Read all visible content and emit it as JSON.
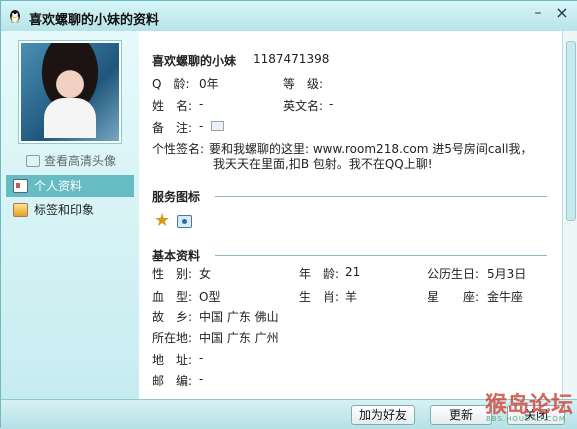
{
  "window": {
    "title": "喜欢螺聊的小妹的资料"
  },
  "sidebar": {
    "hd_link": "查看高清头像",
    "items": [
      {
        "label": "个人资料",
        "active": true,
        "icon": "profile-card-icon"
      },
      {
        "label": "标签和印象",
        "active": false,
        "icon": "tag-icon"
      }
    ]
  },
  "profile": {
    "nickname": "喜欢螺聊的小妹",
    "qq_number": "1187471398",
    "q_age_label": "Q　龄:",
    "q_age_value": "0年",
    "level_label": "等　级:",
    "name_label": "姓　名:",
    "name_value": "-",
    "english_name_label": "英文名:",
    "english_name_value": "-",
    "memo_label": "备　注:",
    "memo_value": "-",
    "signature_label": "个性签名:",
    "signature_line1": "要和我螺聊的这里: www.room218.com 进5号房间call我，",
    "signature_line2": "我天天在里面,扣B 包射。我不在QQ上聊!"
  },
  "services": {
    "title": "服务图标",
    "icons": [
      "star-icon",
      "camera-icon"
    ]
  },
  "basic": {
    "title": "基本资料",
    "gender_label": "性　别:",
    "gender_value": "女",
    "age_label": "年　龄:",
    "age_value": "21",
    "birthday_label": "公历生日:",
    "birthday_value": "5月3日",
    "blood_label": "血　型:",
    "blood_value": "O型",
    "zodiac_label": "生　肖:",
    "zodiac_value": "羊",
    "constellation_label": "星　　座:",
    "constellation_value": "金牛座",
    "hometown_label": "故　乡:",
    "hometown_value": "中国 广东 佛山",
    "location_label": "所在地:",
    "location_value": "中国 广东 广州",
    "address_label": "地　址:",
    "address_value": "-",
    "postcode_label": "邮　编:",
    "postcode_value": "-"
  },
  "footer": {
    "add_friend": "加为好友",
    "refresh": "更新",
    "close": "关闭"
  },
  "watermark": {
    "main": "猴岛论坛",
    "sub": "BBS.HOUDAO.COM"
  }
}
